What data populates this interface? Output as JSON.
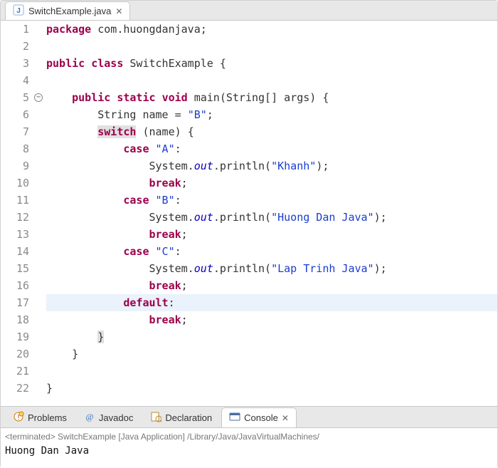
{
  "editor_tab": {
    "filename": "SwitchExample.java",
    "close_glyph": "✕"
  },
  "code": {
    "lines": [
      {
        "n": 1,
        "t": [
          [
            "kw",
            "package"
          ],
          [
            "plain",
            " com.huongdanjava"
          ],
          [
            "punc",
            ";"
          ]
        ]
      },
      {
        "n": 2,
        "t": []
      },
      {
        "n": 3,
        "t": [
          [
            "kw",
            "public"
          ],
          [
            "plain",
            " "
          ],
          [
            "kw",
            "class"
          ],
          [
            "plain",
            " SwitchExample "
          ],
          [
            "punc",
            "{"
          ]
        ]
      },
      {
        "n": 4,
        "t": []
      },
      {
        "n": 5,
        "fold": true,
        "t": [
          [
            "plain",
            "    "
          ],
          [
            "kw",
            "public"
          ],
          [
            "plain",
            " "
          ],
          [
            "kw",
            "static"
          ],
          [
            "plain",
            " "
          ],
          [
            "typ",
            "void"
          ],
          [
            "plain",
            " main(String[] args) "
          ],
          [
            "punc",
            "{"
          ]
        ]
      },
      {
        "n": 6,
        "t": [
          [
            "plain",
            "        String name = "
          ],
          [
            "str",
            "\"B\""
          ],
          [
            "punc",
            ";"
          ]
        ]
      },
      {
        "n": 7,
        "t": [
          [
            "plain",
            "        "
          ],
          [
            "sel-kw",
            "switch"
          ],
          [
            "plain",
            " (name) "
          ],
          [
            "punc",
            "{"
          ]
        ]
      },
      {
        "n": 8,
        "t": [
          [
            "plain",
            "            "
          ],
          [
            "kw",
            "case"
          ],
          [
            "plain",
            " "
          ],
          [
            "str",
            "\"A\""
          ],
          [
            "punc",
            ":"
          ]
        ]
      },
      {
        "n": 9,
        "t": [
          [
            "plain",
            "                System."
          ],
          [
            "fld",
            "out"
          ],
          [
            "plain",
            ".println("
          ],
          [
            "str",
            "\"Khanh\""
          ],
          [
            "plain",
            ")"
          ],
          [
            "punc",
            ";"
          ]
        ]
      },
      {
        "n": 10,
        "t": [
          [
            "plain",
            "                "
          ],
          [
            "kw",
            "break"
          ],
          [
            "punc",
            ";"
          ]
        ]
      },
      {
        "n": 11,
        "t": [
          [
            "plain",
            "            "
          ],
          [
            "kw",
            "case"
          ],
          [
            "plain",
            " "
          ],
          [
            "str",
            "\"B\""
          ],
          [
            "punc",
            ":"
          ]
        ]
      },
      {
        "n": 12,
        "t": [
          [
            "plain",
            "                System."
          ],
          [
            "fld",
            "out"
          ],
          [
            "plain",
            ".println("
          ],
          [
            "str",
            "\"Huong Dan Java\""
          ],
          [
            "plain",
            ")"
          ],
          [
            "punc",
            ";"
          ]
        ]
      },
      {
        "n": 13,
        "t": [
          [
            "plain",
            "                "
          ],
          [
            "kw",
            "break"
          ],
          [
            "punc",
            ";"
          ]
        ]
      },
      {
        "n": 14,
        "t": [
          [
            "plain",
            "            "
          ],
          [
            "kw",
            "case"
          ],
          [
            "plain",
            " "
          ],
          [
            "str",
            "\"C\""
          ],
          [
            "punc",
            ":"
          ]
        ]
      },
      {
        "n": 15,
        "t": [
          [
            "plain",
            "                System."
          ],
          [
            "fld",
            "out"
          ],
          [
            "plain",
            ".println("
          ],
          [
            "str",
            "\"Lap Trinh Java\""
          ],
          [
            "plain",
            ")"
          ],
          [
            "punc",
            ";"
          ]
        ]
      },
      {
        "n": 16,
        "t": [
          [
            "plain",
            "                "
          ],
          [
            "kw",
            "break"
          ],
          [
            "punc",
            ";"
          ]
        ]
      },
      {
        "n": 17,
        "hl": true,
        "t": [
          [
            "plain",
            "            "
          ],
          [
            "kw",
            "default"
          ],
          [
            "punc",
            ":"
          ]
        ]
      },
      {
        "n": 18,
        "t": [
          [
            "plain",
            "                "
          ],
          [
            "kw",
            "break"
          ],
          [
            "punc",
            ";"
          ]
        ]
      },
      {
        "n": 19,
        "t": [
          [
            "plain",
            "        "
          ],
          [
            "sel",
            "}"
          ]
        ]
      },
      {
        "n": 20,
        "t": [
          [
            "plain",
            "    "
          ],
          [
            "punc",
            "}"
          ]
        ]
      },
      {
        "n": 21,
        "t": []
      },
      {
        "n": 22,
        "t": [
          [
            "punc",
            "}"
          ]
        ]
      }
    ]
  },
  "views": {
    "items": [
      {
        "id": "problems",
        "label": "Problems",
        "icon": "problems-icon"
      },
      {
        "id": "javadoc",
        "label": "Javadoc",
        "icon": "javadoc-icon"
      },
      {
        "id": "declaration",
        "label": "Declaration",
        "icon": "declaration-icon"
      },
      {
        "id": "console",
        "label": "Console",
        "icon": "console-icon",
        "active": true,
        "closable": true
      }
    ],
    "close_glyph": "✕"
  },
  "console": {
    "terminated_line": "<terminated> SwitchExample [Java Application] /Library/Java/JavaVirtualMachines/",
    "output": "Huong Dan Java"
  }
}
